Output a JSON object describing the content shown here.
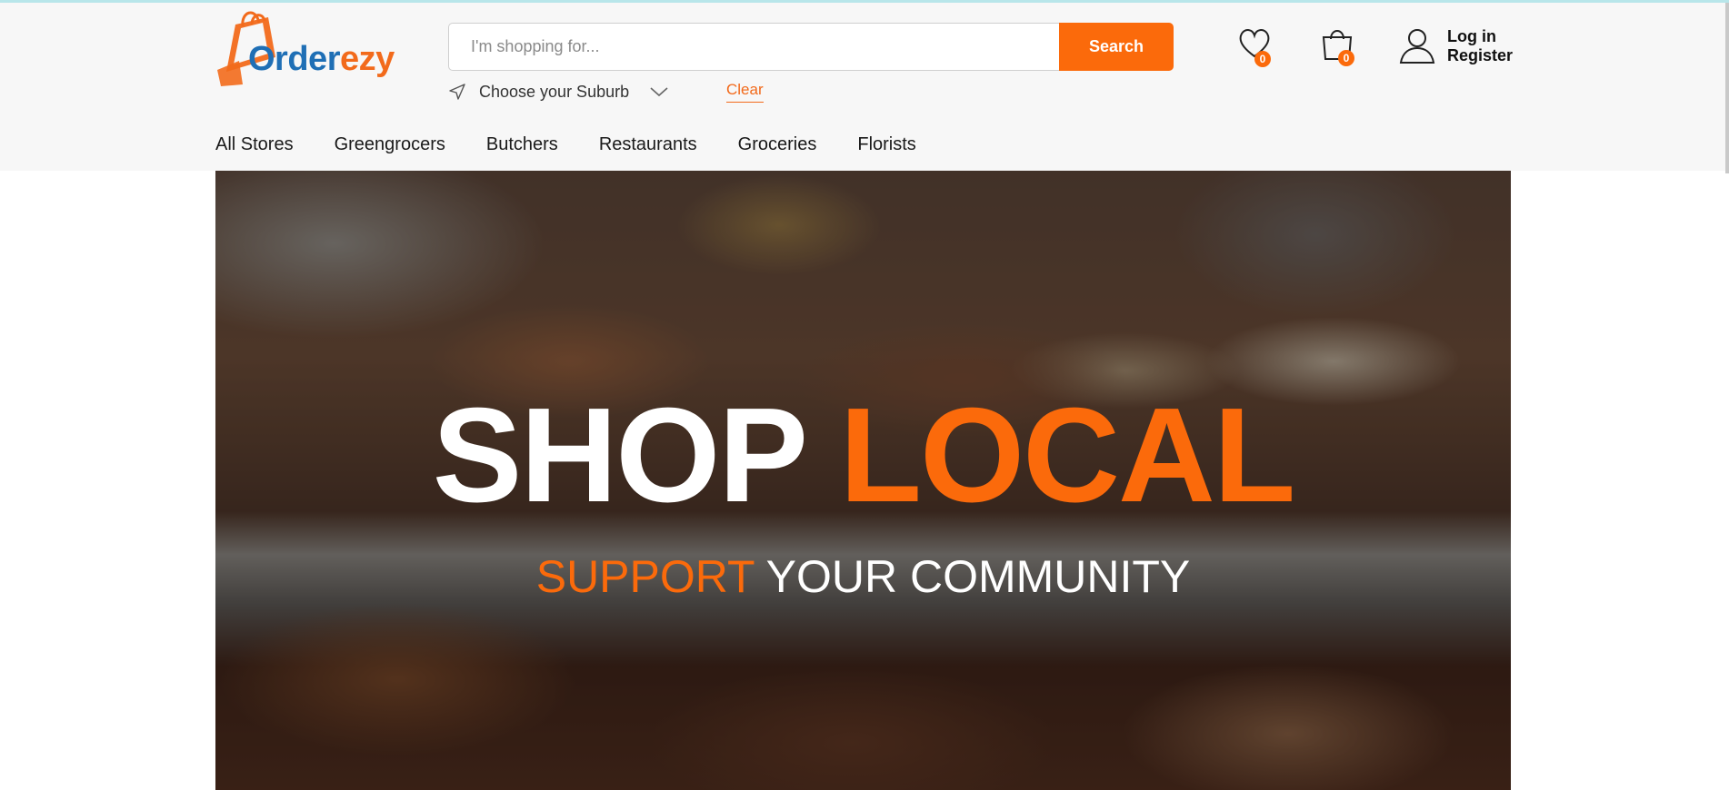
{
  "brand": {
    "logo_part1": "Order",
    "logo_part2": "ezy",
    "accent": "#fb6a0b",
    "blue": "#1f6fb5"
  },
  "search": {
    "placeholder": "I'm shopping for...",
    "value": "",
    "button_label": "Search"
  },
  "location": {
    "suburb_label": "Choose your Suburb",
    "clear_label": "Clear"
  },
  "header_icons": {
    "wishlist_icon": "heart-icon",
    "wishlist_count": "0",
    "cart_icon": "shopping-bag-icon",
    "cart_count": "0",
    "account_icon": "user-icon"
  },
  "account": {
    "login_label": "Log in",
    "register_label": "Register"
  },
  "nav": {
    "items": [
      "All Stores",
      "Greengrocers",
      "Butchers",
      "Restaurants",
      "Groceries",
      "Florists"
    ]
  },
  "hero": {
    "title_part1": "SHOP",
    "title_part2": "LOCAL",
    "subtitle_part1": "SUPPORT",
    "subtitle_part2": "YOUR COMMUNITY"
  }
}
